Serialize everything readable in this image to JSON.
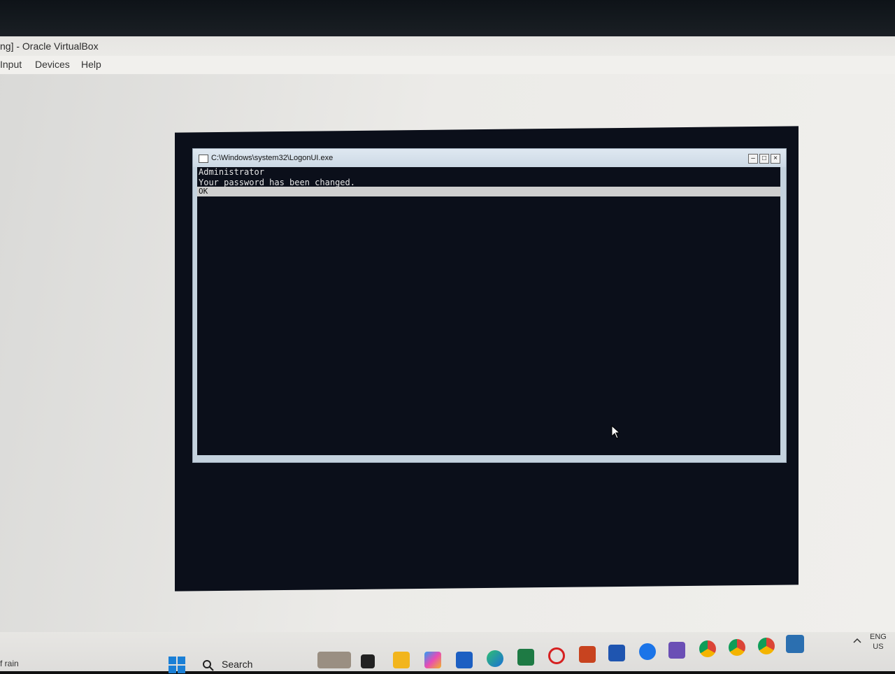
{
  "host_window": {
    "title": "ng] - Oracle VirtualBox",
    "menu": [
      "Input",
      "Devices",
      "Help"
    ]
  },
  "logon_window": {
    "title": "C:\\Windows\\system32\\LogonUI.exe",
    "line1": "Administrator",
    "line2": "Your password has been changed.",
    "ok_label": "OK"
  },
  "taskbar": {
    "weather_text": "f rain",
    "search_label": "Search",
    "lang_line1": "ENG",
    "lang_line2": "US",
    "icons": [
      "start-icon",
      "search-icon",
      "widgets-icon",
      "task-view-icon",
      "file-explorer-icon",
      "copilot-icon",
      "store-icon",
      "edge-icon",
      "excel-icon",
      "opera-icon",
      "powerpoint-icon",
      "word-icon",
      "messenger-icon",
      "vs-icon",
      "chrome-icon",
      "chrome-icon-2",
      "chrome-icon-3",
      "app-icon"
    ]
  },
  "colors": {
    "vm_background": "#0b0f1a",
    "logon_frame": "#c4d2de",
    "ok_bar": "#cfcfcf"
  }
}
